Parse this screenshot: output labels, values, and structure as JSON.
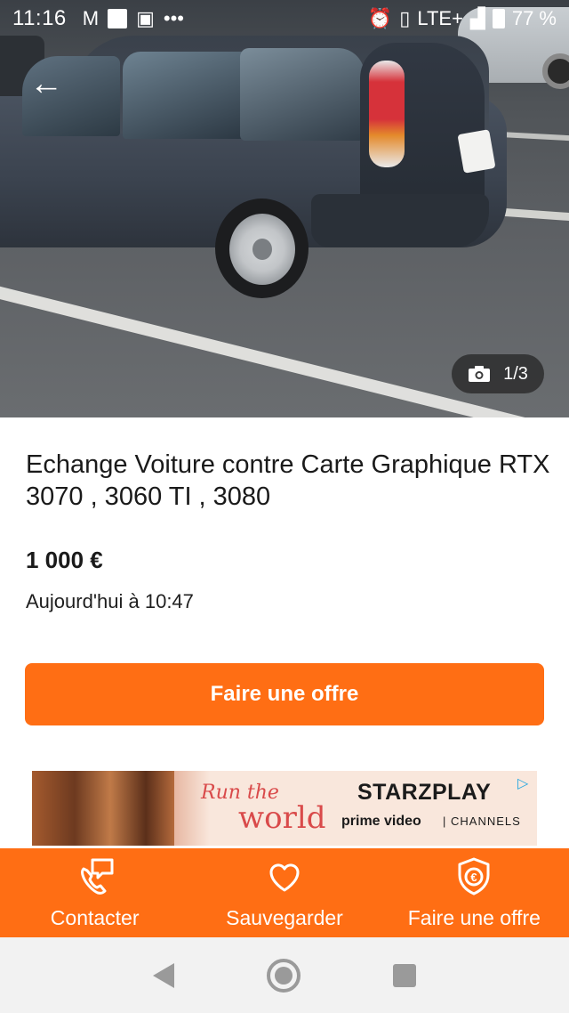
{
  "status_bar": {
    "time": "11:16",
    "network": "LTE+",
    "battery": "77 %",
    "icons": [
      "gmail-icon",
      "notification-icon",
      "twitch-icon",
      "more-dots-icon",
      "alarm-icon",
      "vibrate-icon",
      "signal-icon",
      "battery-icon"
    ]
  },
  "gallery": {
    "counter": "1/3",
    "camera_icon": "camera-icon",
    "back_icon": "arrow-left-icon"
  },
  "listing": {
    "title": "Echange Voiture contre Carte Graphique RTX 3070 , 3060 TI , 3080",
    "price": "1 000 €",
    "date": "Aujourd'hui à 10:47",
    "offer_button": "Faire une offre"
  },
  "ad": {
    "show_line1": "Run the",
    "show_line2": "world",
    "brand": "STARZPLAY",
    "provider": "prime video",
    "channels": "CHANNELS"
  },
  "bottom_bar": {
    "items": [
      {
        "label": "Contacter",
        "icon": "phone-chat-icon"
      },
      {
        "label": "Sauvegarder",
        "icon": "heart-icon"
      },
      {
        "label": "Faire une offre",
        "icon": "euro-shield-icon"
      }
    ]
  },
  "colors": {
    "accent": "#ff6e14",
    "text": "#1a1a1a",
    "navbar": "#f2f2f2"
  }
}
